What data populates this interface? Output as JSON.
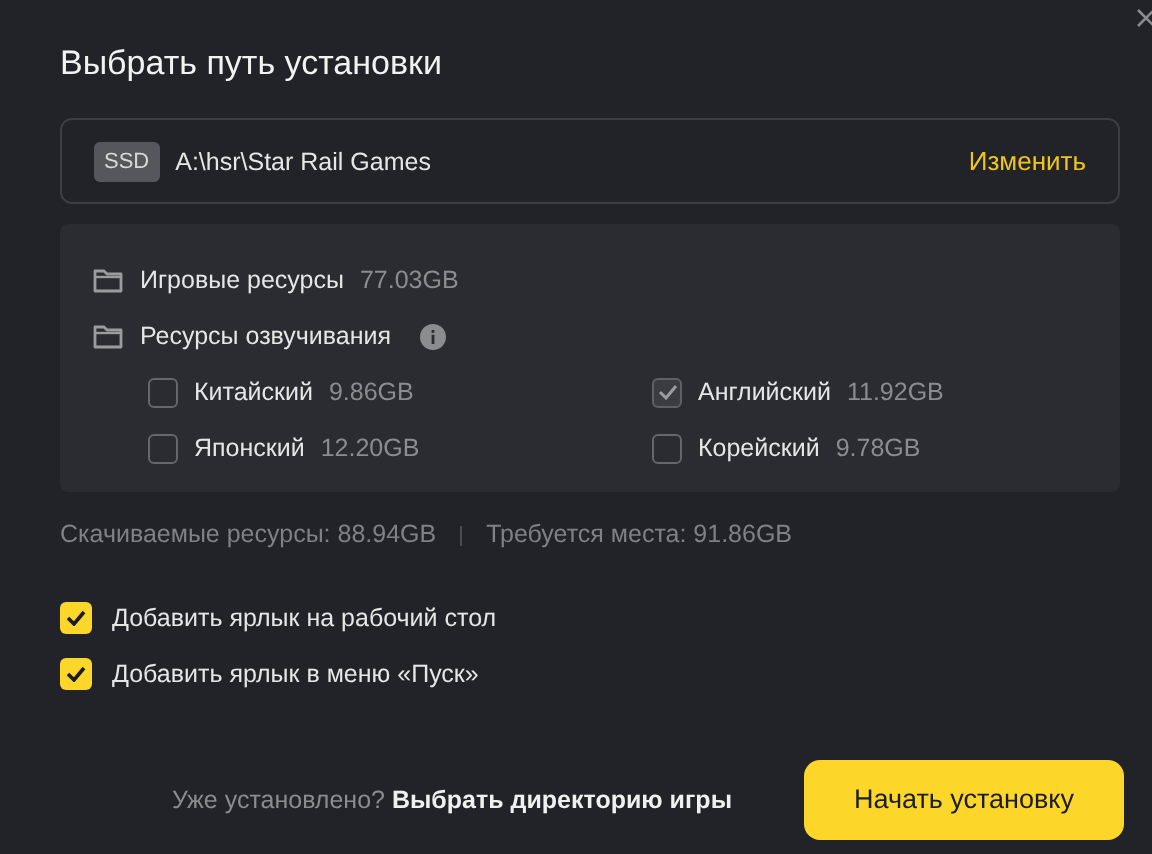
{
  "window": {
    "title": "Выбрать путь установки"
  },
  "path": {
    "drive": "SSD",
    "value": "A:\\hsr\\Star Rail Games",
    "action": "Изменить"
  },
  "resources": [
    {
      "label": "Игровые ресурсы",
      "size": "77.03GB",
      "info": false
    },
    {
      "label": "Ресурсы озвучивания",
      "info": true
    }
  ],
  "languages": [
    {
      "label": "Китайский",
      "size": "9.86GB",
      "checked": false,
      "disabled": false
    },
    {
      "label": "Английский",
      "size": "11.92GB",
      "checked": true,
      "disabled": true
    },
    {
      "label": "Японский",
      "size": "12.20GB",
      "checked": false,
      "disabled": false
    },
    {
      "label": "Корейский",
      "size": "9.78GB",
      "checked": false,
      "disabled": false
    }
  ],
  "stats": [
    "Скачиваемые ресурсы: 88.94GB",
    "Требуется места: 91.86GB"
  ],
  "options": [
    {
      "label": "Добавить ярлык на рабочий стол",
      "checked": true
    },
    {
      "label": "Добавить ярлык в меню «Пуск»",
      "checked": true
    }
  ],
  "footer": {
    "question": "Уже установлено?",
    "link": "Выбрать директорию игры",
    "button": "Начать установку"
  }
}
